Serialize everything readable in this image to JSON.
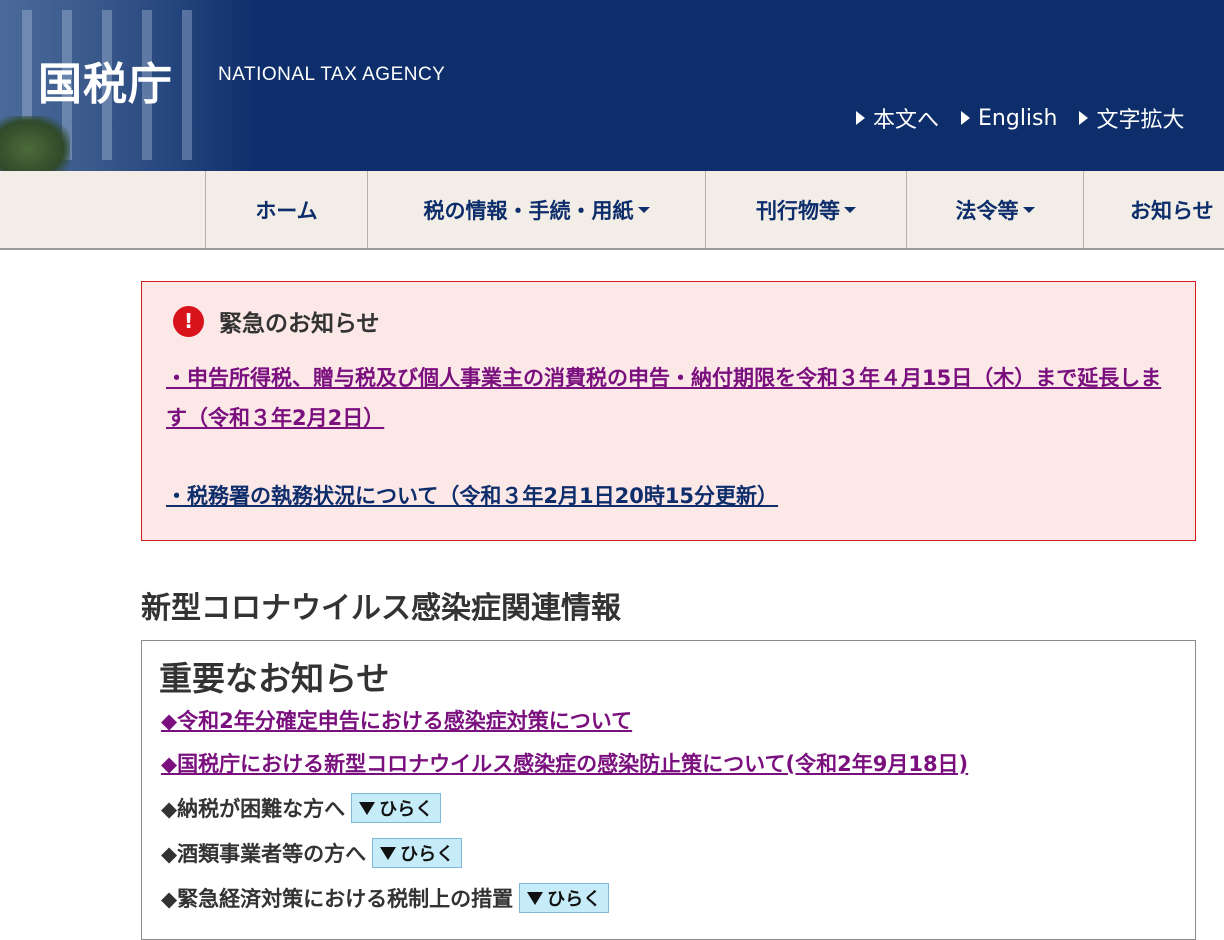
{
  "header": {
    "logo": "国税庁",
    "subtitle": "NATIONAL TAX AGENCY",
    "util_links": [
      "本文へ",
      "English",
      "文字拡大"
    ]
  },
  "nav": {
    "items": [
      {
        "label": "ホーム",
        "dropdown": false
      },
      {
        "label": "税の情報・手続・用紙",
        "dropdown": true
      },
      {
        "label": "刊行物等",
        "dropdown": true
      },
      {
        "label": "法令等",
        "dropdown": true
      },
      {
        "label": "お知らせ",
        "dropdown": false
      }
    ]
  },
  "emergency": {
    "title": "緊急のお知らせ",
    "icon": "exclamation-icon",
    "links": [
      "・申告所得税、贈与税及び個人事業主の消費税の申告・納付期限を令和３年４月15日（木）まで延長します（令和３年2月2日）",
      "・税務署の執務状況について（令和３年2月1日20時15分更新）"
    ]
  },
  "section": {
    "title": "新型コロナウイルス感染症関連情報",
    "box_title": "重要なお知らせ",
    "links": [
      "◆令和2年分確定申告における感染症対策について",
      "◆国税庁における新型コロナウイルス感染症の感染防止策について(令和2年9月18日)"
    ],
    "toggles": [
      {
        "label": "◆納税が困難な方へ",
        "button": "ひらく"
      },
      {
        "label": "◆酒類事業者等の方へ",
        "button": "ひらく"
      },
      {
        "label": "◆緊急経済対策における税制上の措置",
        "button": "ひらく"
      }
    ]
  },
  "colors": {
    "header_bg": "#0d2d6b",
    "nav_bg": "#f2ede6",
    "emergency_bg": "#fde8e8",
    "emergency_border": "#d21c1c",
    "visited_link": "#7a0f7e",
    "link": "#0d2d6b",
    "toggle_btn": "#c6ecfa"
  }
}
